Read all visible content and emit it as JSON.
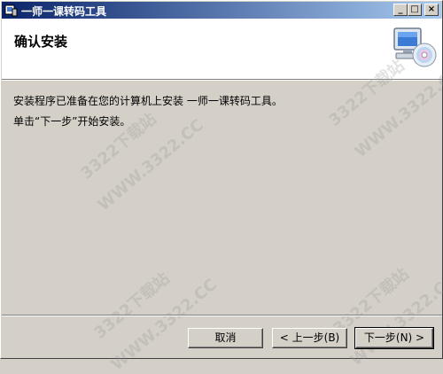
{
  "window": {
    "title": "一师一课转码工具",
    "controls": {
      "minimize": "_",
      "maximize": "□",
      "close": "×"
    }
  },
  "header": {
    "title": "确认安装",
    "icon": "computer-cd-icon"
  },
  "content": {
    "line1": "安装程序已准备在您的计算机上安装 一师一课转码工具。",
    "line2": "单击“下一步”开始安装。"
  },
  "buttons": {
    "cancel": "取消",
    "back": "< 上一步(B)",
    "next": "下一步(N) >"
  },
  "watermark": {
    "text1": "3322下载站",
    "text2": "WWW.3322.CC"
  }
}
